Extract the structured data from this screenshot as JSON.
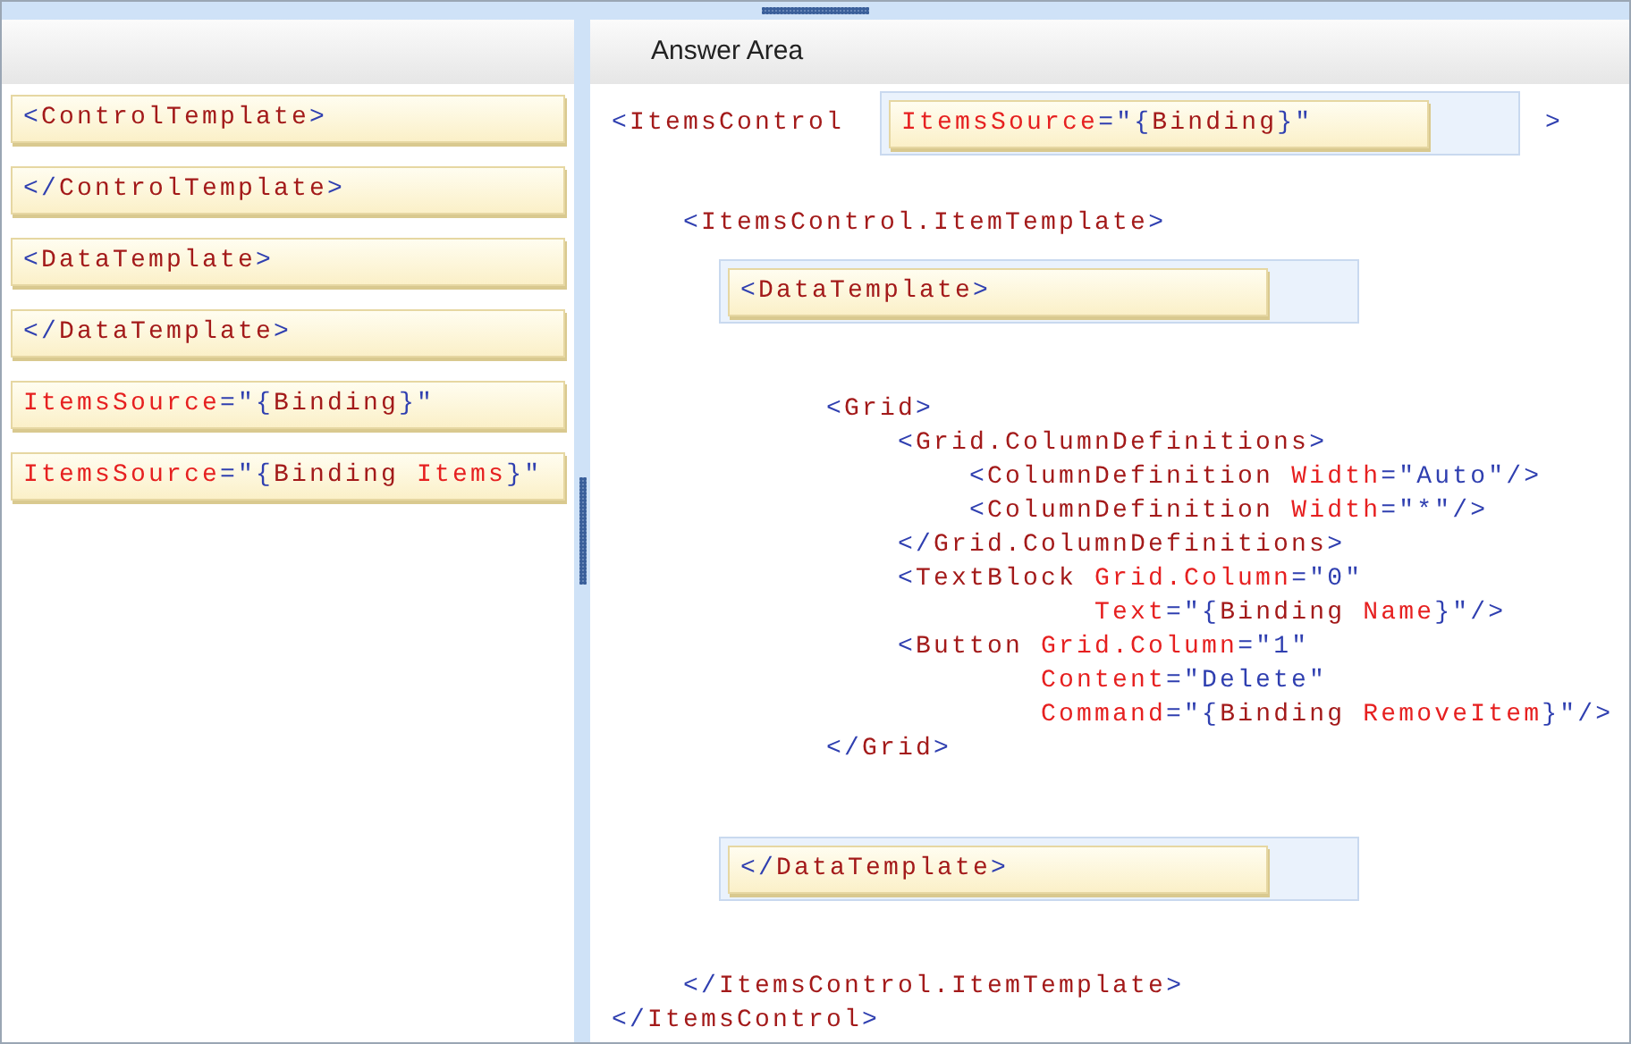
{
  "choices": [
    {
      "parts": [
        {
          "kind": "bracket",
          "text": "<"
        },
        {
          "kind": "element",
          "text": "ControlTemplate"
        },
        {
          "kind": "bracket",
          "text": ">"
        }
      ]
    },
    {
      "parts": [
        {
          "kind": "bracket",
          "text": "</"
        },
        {
          "kind": "element",
          "text": "ControlTemplate"
        },
        {
          "kind": "bracket",
          "text": ">"
        }
      ]
    },
    {
      "parts": [
        {
          "kind": "bracket",
          "text": "<"
        },
        {
          "kind": "element",
          "text": "DataTemplate"
        },
        {
          "kind": "bracket",
          "text": ">"
        }
      ]
    },
    {
      "parts": [
        {
          "kind": "bracket",
          "text": "</"
        },
        {
          "kind": "element",
          "text": "DataTemplate"
        },
        {
          "kind": "bracket",
          "text": ">"
        }
      ]
    },
    {
      "parts": [
        {
          "kind": "attribute",
          "text": "ItemsSource"
        },
        {
          "kind": "bracket",
          "text": "=\"{"
        },
        {
          "kind": "element",
          "text": "Binding"
        },
        {
          "kind": "bracket",
          "text": "}\""
        }
      ]
    },
    {
      "parts": [
        {
          "kind": "attribute",
          "text": "ItemsSource"
        },
        {
          "kind": "bracket",
          "text": "=\"{"
        },
        {
          "kind": "element",
          "text": "Binding"
        },
        {
          "kind": "attribute",
          "text": " Items"
        },
        {
          "kind": "bracket",
          "text": "}\""
        }
      ]
    }
  ],
  "answer_area": {
    "title": "Answer Area",
    "lines": [
      {
        "kind": "code",
        "parts": [
          {
            "kind": "bracket",
            "text": "<"
          },
          {
            "kind": "element",
            "text": "ItemsControl "
          },
          {
            "kind": "slot",
            "parts": [
              {
                "kind": "attribute",
                "text": "ItemsSource"
              },
              {
                "kind": "bracket",
                "text": "=\"{"
              },
              {
                "kind": "element",
                "text": "Binding"
              },
              {
                "kind": "bracket",
                "text": "}\""
              }
            ]
          },
          {
            "kind": "bracket",
            "text": ">"
          }
        ]
      },
      {
        "kind": "blank"
      },
      {
        "kind": "code",
        "parts": [
          {
            "kind": "bracket",
            "text": "    <"
          },
          {
            "kind": "element",
            "text": "ItemsControl.ItemTemplate"
          },
          {
            "kind": "bracket",
            "text": ">"
          }
        ]
      },
      {
        "kind": "slot",
        "parts": [
          {
            "kind": "bracket",
            "text": "<"
          },
          {
            "kind": "element",
            "text": "DataTemplate"
          },
          {
            "kind": "bracket",
            "text": ">"
          }
        ]
      },
      {
        "kind": "blank"
      },
      {
        "kind": "code",
        "parts": [
          {
            "kind": "bracket",
            "text": "            <"
          },
          {
            "kind": "element",
            "text": "Grid"
          },
          {
            "kind": "bracket",
            "text": ">"
          }
        ]
      },
      {
        "kind": "code",
        "parts": [
          {
            "kind": "bracket",
            "text": "                <"
          },
          {
            "kind": "element",
            "text": "Grid.ColumnDefinitions"
          },
          {
            "kind": "bracket",
            "text": ">"
          }
        ]
      },
      {
        "kind": "code",
        "parts": [
          {
            "kind": "bracket",
            "text": "                    <"
          },
          {
            "kind": "element",
            "text": "ColumnDefinition "
          },
          {
            "kind": "attribute",
            "text": "Width"
          },
          {
            "kind": "bracket",
            "text": "=\"Auto\"/>"
          }
        ]
      },
      {
        "kind": "code",
        "parts": [
          {
            "kind": "bracket",
            "text": "                    <"
          },
          {
            "kind": "element",
            "text": "ColumnDefinition "
          },
          {
            "kind": "attribute",
            "text": "Width"
          },
          {
            "kind": "bracket",
            "text": "=\"*\"/>"
          }
        ]
      },
      {
        "kind": "code",
        "parts": [
          {
            "kind": "bracket",
            "text": "                </"
          },
          {
            "kind": "element",
            "text": "Grid.ColumnDefinitions"
          },
          {
            "kind": "bracket",
            "text": ">"
          }
        ]
      },
      {
        "kind": "code",
        "parts": [
          {
            "kind": "bracket",
            "text": "                <"
          },
          {
            "kind": "element",
            "text": "TextBlock "
          },
          {
            "kind": "attribute",
            "text": "Grid.Column"
          },
          {
            "kind": "bracket",
            "text": "=\"0\""
          }
        ]
      },
      {
        "kind": "code",
        "parts": [
          {
            "kind": "attribute",
            "text": "                           Text"
          },
          {
            "kind": "bracket",
            "text": "=\"{"
          },
          {
            "kind": "element",
            "text": "Binding"
          },
          {
            "kind": "attribute",
            "text": " Name"
          },
          {
            "kind": "bracket",
            "text": "}\"/>"
          }
        ]
      },
      {
        "kind": "code",
        "parts": [
          {
            "kind": "bracket",
            "text": "                <"
          },
          {
            "kind": "element",
            "text": "Button "
          },
          {
            "kind": "attribute",
            "text": "Grid.Column"
          },
          {
            "kind": "bracket",
            "text": "=\"1\""
          }
        ]
      },
      {
        "kind": "code",
        "parts": [
          {
            "kind": "attribute",
            "text": "                        Content"
          },
          {
            "kind": "bracket",
            "text": "=\"Delete\""
          }
        ]
      },
      {
        "kind": "code",
        "parts": [
          {
            "kind": "attribute",
            "text": "                        Command"
          },
          {
            "kind": "bracket",
            "text": "=\"{"
          },
          {
            "kind": "element",
            "text": "Binding"
          },
          {
            "kind": "attribute",
            "text": " RemoveItem"
          },
          {
            "kind": "bracket",
            "text": "}\"/>"
          }
        ]
      },
      {
        "kind": "code",
        "parts": [
          {
            "kind": "bracket",
            "text": "            </"
          },
          {
            "kind": "element",
            "text": "Grid"
          },
          {
            "kind": "bracket",
            "text": ">"
          }
        ]
      },
      {
        "kind": "blank"
      },
      {
        "kind": "slot",
        "parts": [
          {
            "kind": "bracket",
            "text": "</"
          },
          {
            "kind": "element",
            "text": "DataTemplate"
          },
          {
            "kind": "bracket",
            "text": ">"
          }
        ]
      },
      {
        "kind": "blank"
      },
      {
        "kind": "code",
        "parts": [
          {
            "kind": "bracket",
            "text": "    </"
          },
          {
            "kind": "element",
            "text": "ItemsControl.ItemTemplate"
          },
          {
            "kind": "bracket",
            "text": ">"
          }
        ]
      },
      {
        "kind": "code",
        "parts": [
          {
            "kind": "bracket",
            "text": "</"
          },
          {
            "kind": "element",
            "text": "ItemsControl"
          },
          {
            "kind": "bracket",
            "text": ">"
          }
        ]
      }
    ]
  }
}
